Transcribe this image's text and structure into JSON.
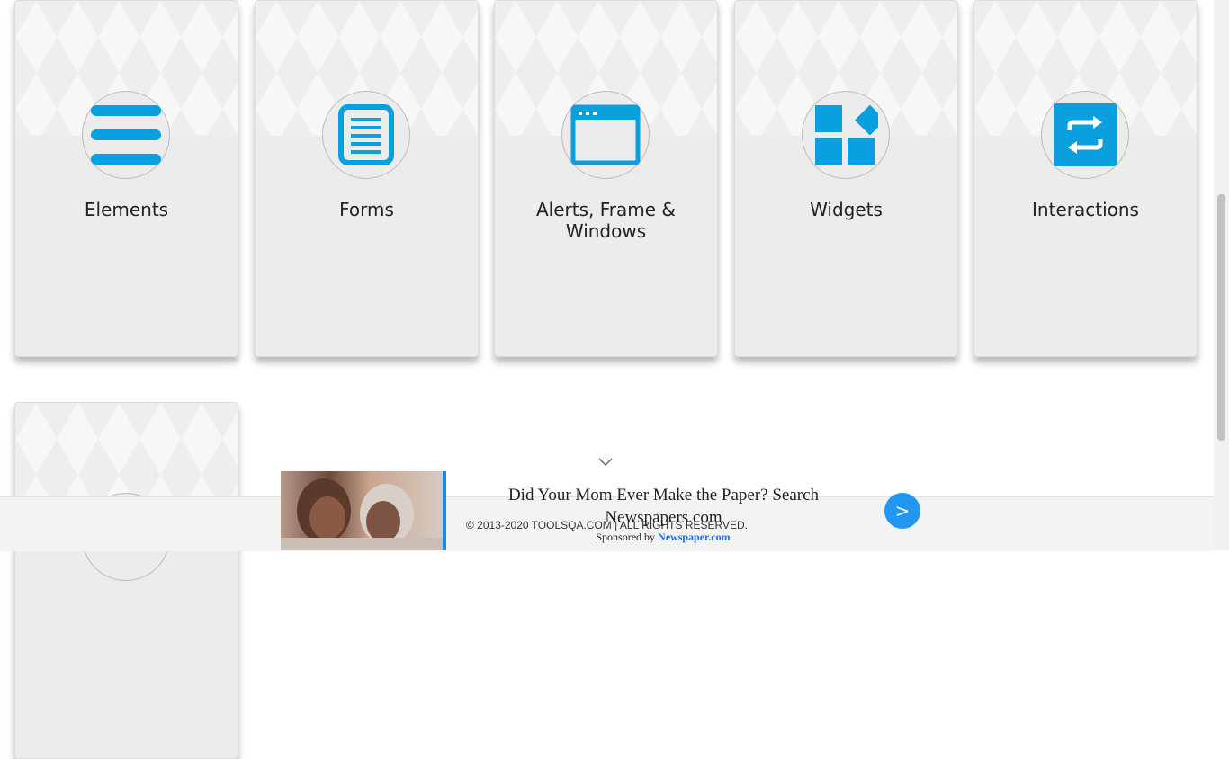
{
  "cards": [
    {
      "label": "Elements",
      "icon": "list-icon"
    },
    {
      "label": "Forms",
      "icon": "document-icon"
    },
    {
      "label": "Alerts, Frame & Windows",
      "icon": "browser-window-icon"
    },
    {
      "label": "Widgets",
      "icon": "widgets-grid-icon"
    },
    {
      "label": "Interactions",
      "icon": "swap-arrows-icon"
    }
  ],
  "footer": {
    "copyright": "© 2013-2020 TOOLSQA.COM | ALL RIGHTS RESERVED."
  },
  "ad": {
    "headline": "Did Your Mom Ever Make the Paper? Search Newspapers.com",
    "sponsored_prefix": "Sponsored by",
    "sponsor": "Newspaper.com",
    "next_label": ">"
  },
  "colors": {
    "accent": "#0a9fdf",
    "ad_button": "#2196f3",
    "card_bg": "#ececec"
  }
}
